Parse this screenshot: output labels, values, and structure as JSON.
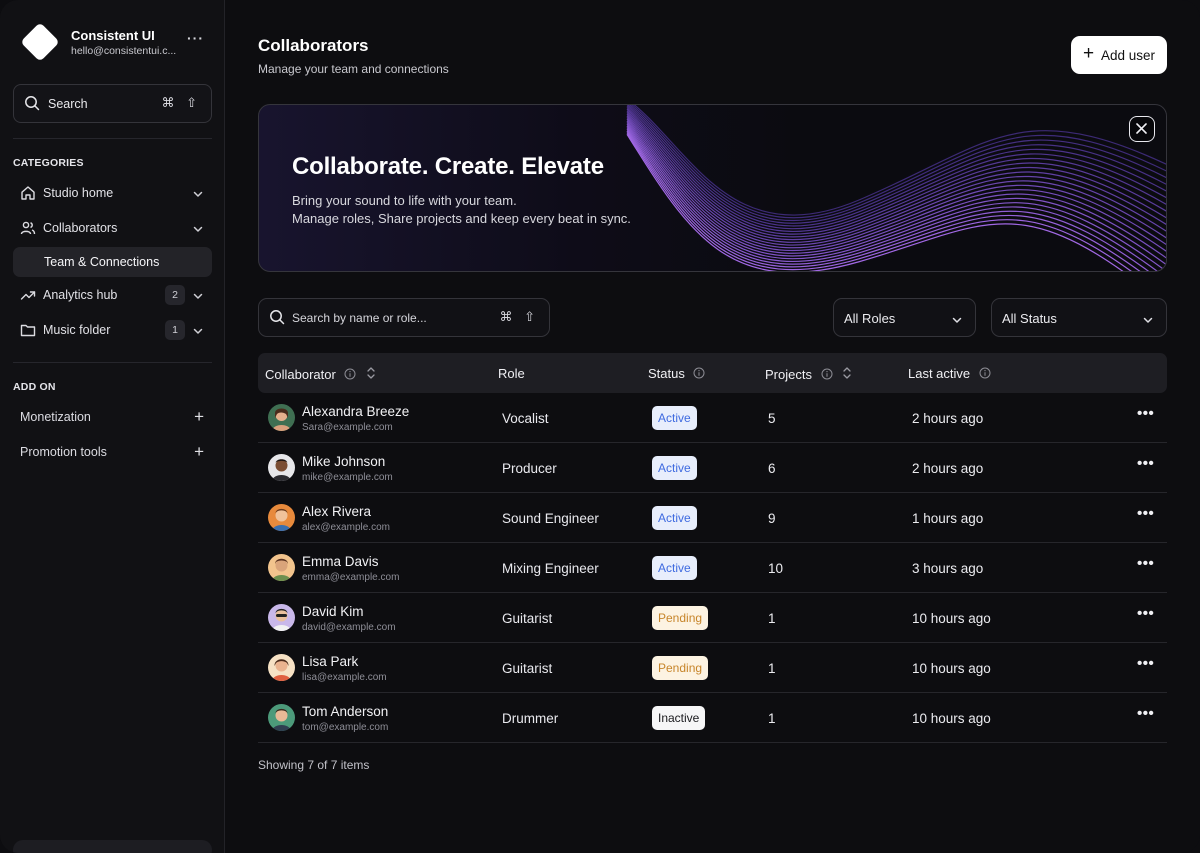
{
  "sidebar": {
    "brand_name": "Consistent UI",
    "brand_email": "hello@consistentui.c...",
    "search_label": "Search",
    "search_shortcut": "⌘ ⇧",
    "categories_label": "CATEGORIES",
    "items": [
      {
        "label": "Studio home",
        "icon": "home-icon"
      },
      {
        "label": "Collaborators",
        "icon": "users-icon"
      },
      {
        "label": "Team & Connections"
      },
      {
        "label": "Analytics hub",
        "icon": "trending-up-icon",
        "badge": "2"
      },
      {
        "label": "Music folder",
        "icon": "folder-icon",
        "badge": "1"
      }
    ],
    "addon_label": "ADD ON",
    "addons": [
      {
        "label": "Monetization"
      },
      {
        "label": "Promotion tools"
      }
    ]
  },
  "header": {
    "title": "Collaborators",
    "subtitle": "Manage your team and connections",
    "add_button": "Add user"
  },
  "banner": {
    "title": "Collaborate. Create. Elevate",
    "line1": "Bring your sound to life with your team.",
    "line2": "Manage roles, Share projects and keep every beat in sync."
  },
  "filters": {
    "search_placeholder": "Search by name or role...",
    "search_shortcut": "⌘ ⇧",
    "roles": "All Roles",
    "status": "All Status"
  },
  "table": {
    "columns": {
      "collaborator": "Collaborator",
      "role": "Role",
      "status": "Status",
      "projects": "Projects",
      "last_active": "Last active"
    },
    "rows": [
      {
        "name": "Alexandra Breeze",
        "email": "Sara@example.com",
        "role": "Vocalist",
        "status": "Active",
        "projects": "5",
        "last_active": "2 hours ago"
      },
      {
        "name": "Mike Johnson",
        "email": "mike@example.com",
        "role": "Producer",
        "status": "Active",
        "projects": "6",
        "last_active": "2 hours ago"
      },
      {
        "name": "Alex Rivera",
        "email": "alex@example.com",
        "role": "Sound Engineer",
        "status": "Active",
        "projects": "9",
        "last_active": "1 hours ago"
      },
      {
        "name": "Emma Davis",
        "email": "emma@example.com",
        "role": "Mixing Engineer",
        "status": "Active",
        "projects": "10",
        "last_active": "3 hours ago"
      },
      {
        "name": "David Kim",
        "email": "david@example.com",
        "role": "Guitarist",
        "status": "Pending",
        "projects": "1",
        "last_active": "10 hours ago"
      },
      {
        "name": "Lisa Park",
        "email": "lisa@example.com",
        "role": "Guitarist",
        "status": "Pending",
        "projects": "1",
        "last_active": "10 hours ago"
      },
      {
        "name": "Tom Anderson",
        "email": "tom@example.com",
        "role": "Drummer",
        "status": "Inactive",
        "projects": "1",
        "last_active": "10 hours ago"
      }
    ],
    "footer": "Showing 7 of 7 items"
  },
  "colors": {
    "active": "#3e6ae0",
    "pending": "#c7852a",
    "accent_wave": "#8b5cf6"
  }
}
